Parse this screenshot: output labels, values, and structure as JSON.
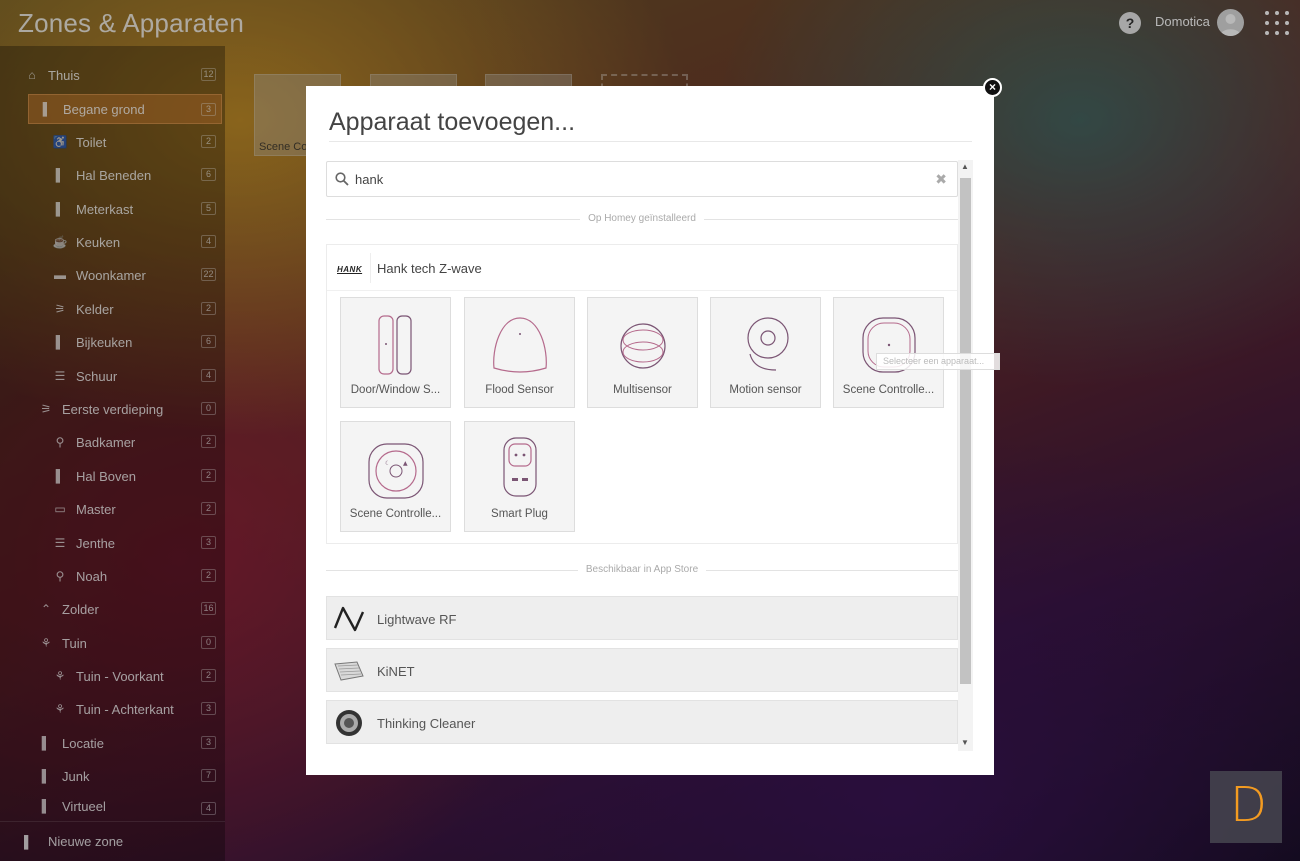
{
  "app": {
    "title": "Zones & Apparaten",
    "user": "Domotica",
    "help": "?"
  },
  "sidebar": {
    "zones": [
      {
        "label": "Thuis",
        "count": "12",
        "icon": "home-icon"
      },
      {
        "label": "Begane grond",
        "count": "3",
        "icon": "door-icon",
        "active": true
      },
      {
        "label": "Toilet",
        "count": "2",
        "icon": "toilet-icon"
      },
      {
        "label": "Hal Beneden",
        "count": "6",
        "icon": "door-icon"
      },
      {
        "label": "Meterkast",
        "count": "5",
        "icon": "door-icon"
      },
      {
        "label": "Keuken",
        "count": "4",
        "icon": "kitchen-icon"
      },
      {
        "label": "Woonkamer",
        "count": "22",
        "icon": "sofa-icon"
      },
      {
        "label": "Kelder",
        "count": "2",
        "icon": "stairs-icon"
      },
      {
        "label": "Bijkeuken",
        "count": "6",
        "icon": "door-icon"
      },
      {
        "label": "Schuur",
        "count": "4",
        "icon": "garage-icon"
      },
      {
        "label": "Eerste verdieping",
        "count": "0",
        "icon": "stairs-icon"
      },
      {
        "label": "Badkamer",
        "count": "2",
        "icon": "shower-icon"
      },
      {
        "label": "Hal Boven",
        "count": "2",
        "icon": "door-icon"
      },
      {
        "label": "Master",
        "count": "2",
        "icon": "bed-icon"
      },
      {
        "label": "Jenthe",
        "count": "3",
        "icon": "garage-icon"
      },
      {
        "label": "Noah",
        "count": "2",
        "icon": "shower-icon"
      },
      {
        "label": "Zolder",
        "count": "16",
        "icon": "roof-icon"
      },
      {
        "label": "Tuin",
        "count": "0",
        "icon": "flower-icon"
      },
      {
        "label": "Tuin - Voorkant",
        "count": "2",
        "icon": "flower-icon"
      },
      {
        "label": "Tuin - Achterkant",
        "count": "3",
        "icon": "flower-icon"
      },
      {
        "label": "Locatie",
        "count": "3",
        "icon": "door-icon"
      },
      {
        "label": "Junk",
        "count": "7",
        "icon": "door-icon"
      },
      {
        "label": "Virtueel",
        "count": "4",
        "icon": "door-icon"
      }
    ],
    "new_zone": "Nieuwe zone"
  },
  "background": {
    "tile_label": "Scene Co"
  },
  "modal": {
    "title": "Apparaat toevoegen...",
    "search_value": "hank",
    "section_installed": "Op Homey geïnstalleerd",
    "brand": {
      "logo_text": "HANK",
      "name": "Hank tech Z-wave"
    },
    "devices": [
      {
        "label": "Door/Window S...",
        "icon": "door-window-sensor-icon"
      },
      {
        "label": "Flood Sensor",
        "icon": "flood-sensor-icon"
      },
      {
        "label": "Multisensor",
        "icon": "multisensor-icon"
      },
      {
        "label": "Motion sensor",
        "icon": "motion-sensor-icon"
      },
      {
        "label": "Scene Controlle...",
        "icon": "scene-controller-icon"
      },
      {
        "label": "Scene Controlle...",
        "icon": "scene-controller-4-icon"
      },
      {
        "label": "Smart Plug",
        "icon": "smart-plug-icon"
      }
    ],
    "tooltip": "Selecteer een apparaat...",
    "section_store": "Beschikbaar in App Store",
    "store_apps": [
      {
        "name": "Lightwave RF",
        "icon": "lightwave-logo-icon"
      },
      {
        "name": "KiNET",
        "icon": "kinet-logo-icon"
      },
      {
        "name": "Thinking Cleaner",
        "icon": "roomba-icon"
      }
    ]
  },
  "corner_badge": "D"
}
